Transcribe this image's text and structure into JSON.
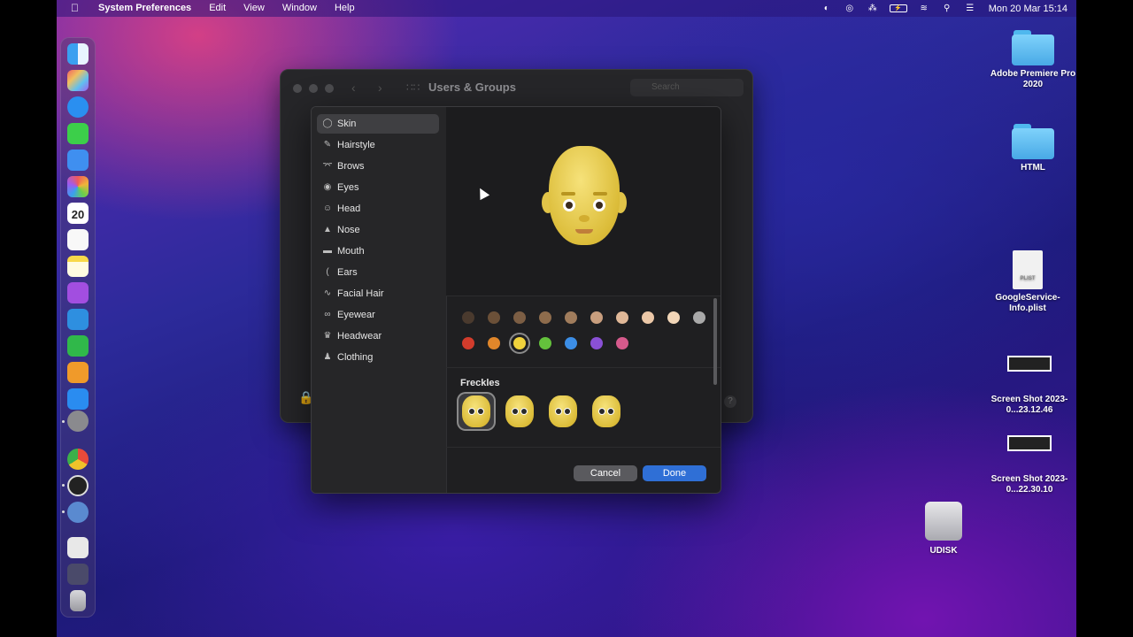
{
  "menubar": {
    "apple_icon": "apple-logo",
    "app_name": "System Preferences",
    "items": [
      "Edit",
      "View",
      "Window",
      "Help"
    ],
    "status_icons": [
      "creative-cloud-icon",
      "cloud-sync-icon",
      "bluetooth-icon",
      "battery-icon",
      "wifi-icon",
      "spotlight-icon",
      "control-center-icon"
    ],
    "clock": "Mon 20 Mar  15:14"
  },
  "dock": {
    "calendar_day": "20",
    "apps": [
      "Finder",
      "Launchpad",
      "Safari",
      "Messages",
      "Mail",
      "Photos",
      "Calendar",
      "Reminders",
      "Notes",
      "Podcasts",
      "Keynote",
      "Numbers",
      "Pages",
      "App Store",
      "System Preferences",
      "Chrome",
      "Clock",
      "Preview",
      "Archive",
      "Screenshot",
      "Trash"
    ]
  },
  "desktop": {
    "items": [
      {
        "type": "folder",
        "label": "Adobe Premiere Pro 2020"
      },
      {
        "type": "folder",
        "label": "HTML"
      },
      {
        "type": "plist",
        "label": "GoogleService-Info.plist",
        "file_badge": "PLIST"
      },
      {
        "type": "screenshot",
        "label": "Screen Shot 2023-0...23.12.46"
      },
      {
        "type": "screenshot",
        "label": "Screen Shot 2023-0...22.30.10"
      },
      {
        "type": "disk",
        "label": "UDISK"
      }
    ]
  },
  "window": {
    "title": "Users & Groups",
    "search_placeholder": "Search",
    "help_label": "?"
  },
  "memoji_editor": {
    "categories": [
      "Skin",
      "Hairstyle",
      "Brows",
      "Eyes",
      "Head",
      "Nose",
      "Mouth",
      "Ears",
      "Facial Hair",
      "Eyewear",
      "Headwear",
      "Clothing"
    ],
    "selected_category": "Skin",
    "skin_colors": [
      "#4a3a2e",
      "#6b5038",
      "#7c5e44",
      "#8e6c4c",
      "#a07c5c",
      "#c89e7e",
      "#e0b898",
      "#ecc8a8",
      "#f2d6b8",
      "#a9a9a9"
    ],
    "fantasy_colors": [
      "#d23c2c",
      "#e0862a",
      "#f0d23c",
      "#64c23c",
      "#3c8ee6",
      "#8a50d6",
      "#d65a8c"
    ],
    "selected_color_index": 2,
    "freckles_label": "Freckles",
    "freckle_options": 4,
    "selected_freckle_index": 0,
    "cancel_label": "Cancel",
    "done_label": "Done"
  }
}
